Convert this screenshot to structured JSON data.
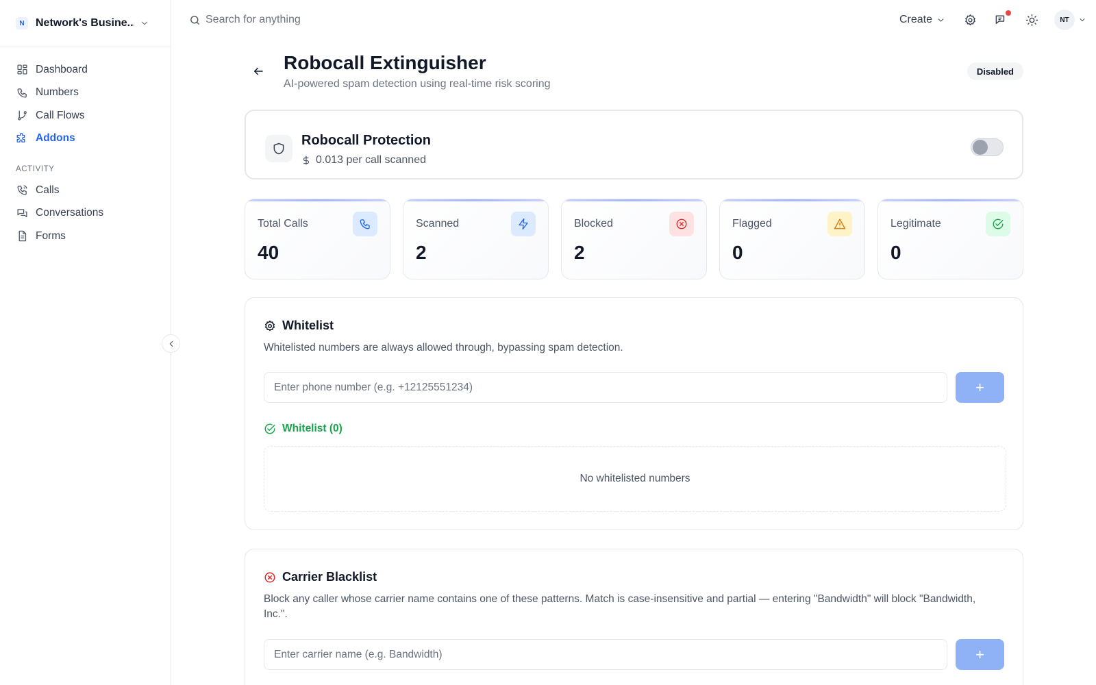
{
  "workspace": {
    "badge": "N",
    "name": "Network's Busine..."
  },
  "sidebar": {
    "items": [
      {
        "label": "Dashboard",
        "icon": "dashboard-icon"
      },
      {
        "label": "Numbers",
        "icon": "phone-icon"
      },
      {
        "label": "Call Flows",
        "icon": "git-branch-icon"
      },
      {
        "label": "Addons",
        "icon": "puzzle-icon",
        "active": true
      }
    ],
    "section_label": "ACTIVITY",
    "activity": [
      {
        "label": "Calls",
        "icon": "phone-call-icon"
      },
      {
        "label": "Conversations",
        "icon": "chat-icon"
      },
      {
        "label": "Forms",
        "icon": "document-icon"
      }
    ]
  },
  "header": {
    "search_placeholder": "Search for anything",
    "create_label": "Create",
    "avatar_initials": "NT"
  },
  "page": {
    "title": "Robocall Extinguisher",
    "subtitle": "AI-powered spam detection using real-time risk scoring",
    "status": "Disabled"
  },
  "protection": {
    "title": "Robocall Protection",
    "price": "0.013 per call scanned",
    "enabled": false
  },
  "stats": [
    {
      "label": "Total Calls",
      "value": "40",
      "icon": "phone-icon",
      "color": "#2563eb",
      "bg": "#dbeafe"
    },
    {
      "label": "Scanned",
      "value": "2",
      "icon": "lightning-icon",
      "color": "#2563eb",
      "bg": "#dbeafe"
    },
    {
      "label": "Blocked",
      "value": "2",
      "icon": "x-circle-icon",
      "color": "#dc2626",
      "bg": "#fee2e2"
    },
    {
      "label": "Flagged",
      "value": "0",
      "icon": "warning-icon",
      "color": "#d97706",
      "bg": "#fef3c7"
    },
    {
      "label": "Legitimate",
      "value": "0",
      "icon": "check-circle-icon",
      "color": "#16a34a",
      "bg": "#dcfce7"
    }
  ],
  "whitelist": {
    "title": "Whitelist",
    "description": "Whitelisted numbers are always allowed through, bypassing spam detection.",
    "input_placeholder": "Enter phone number (e.g. +12125551234)",
    "add_label": "+",
    "list_label": "Whitelist (0)",
    "empty_text": "No whitelisted numbers"
  },
  "blacklist": {
    "title": "Carrier Blacklist",
    "description": "Block any caller whose carrier name contains one of these patterns. Match is case-insensitive and partial — entering \"Bandwidth\" will block \"Bandwidth, Inc.\".",
    "input_placeholder": "Enter carrier name (e.g. Bandwidth)",
    "add_label": "+"
  },
  "colors": {
    "accent": "#2563eb",
    "button": "#8eb2f5",
    "success": "#16a34a",
    "danger": "#dc2626",
    "warning": "#d97706"
  }
}
